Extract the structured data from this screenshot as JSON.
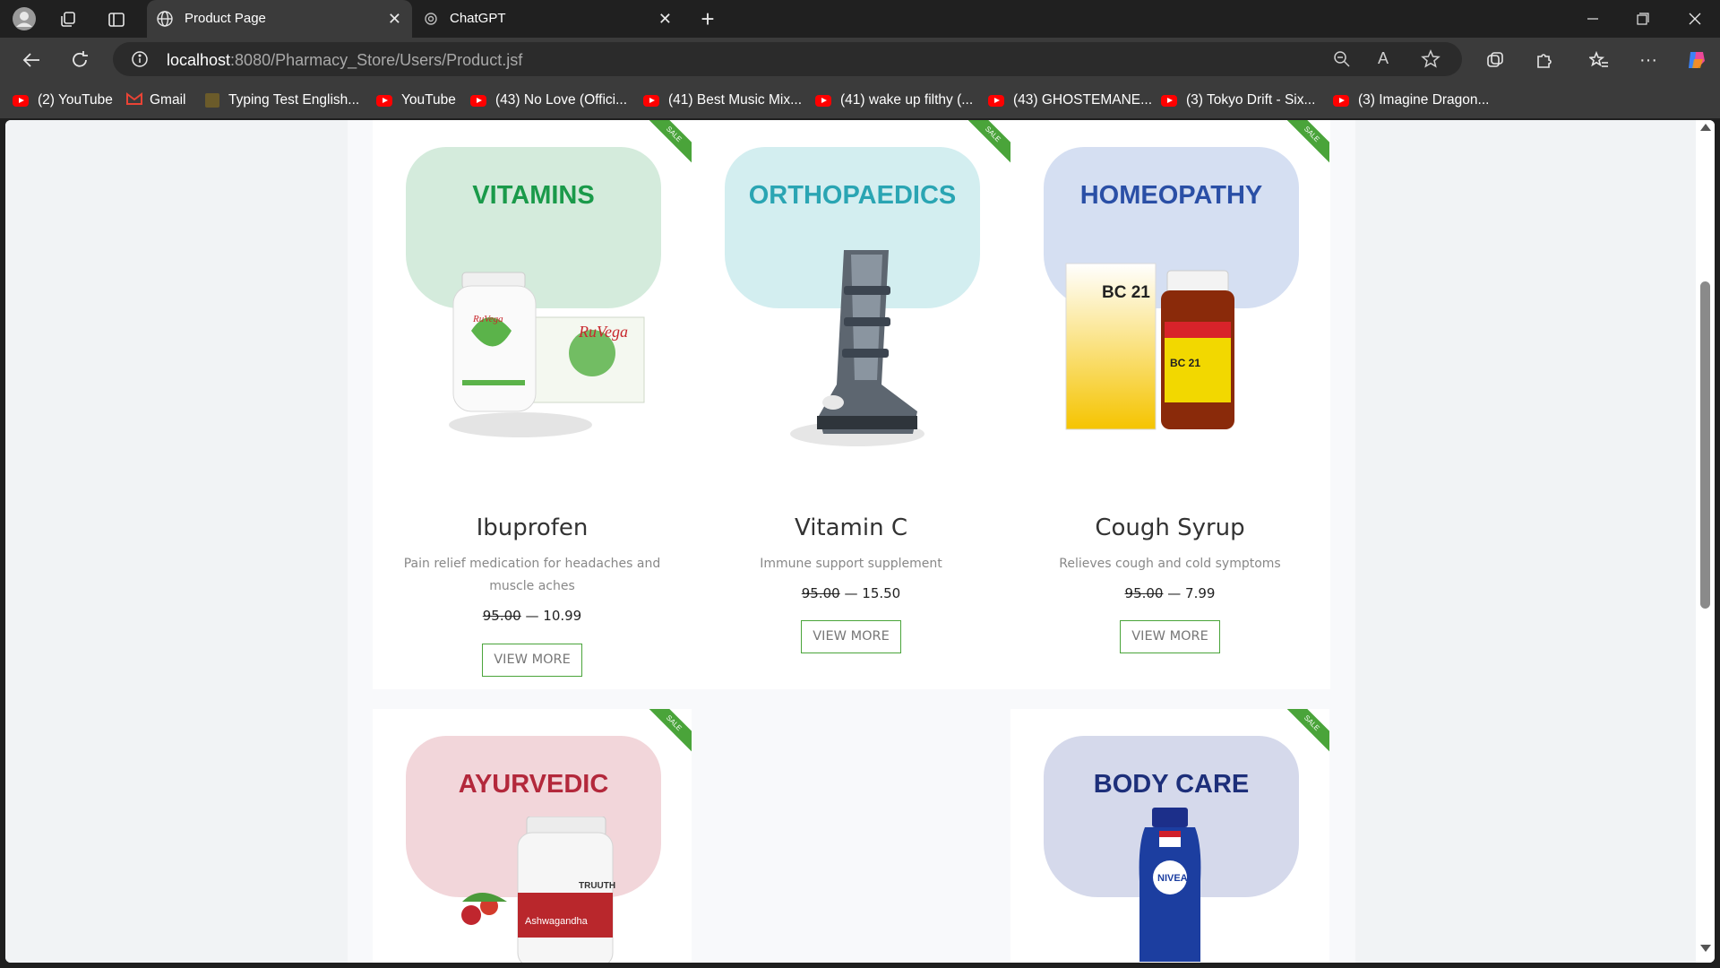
{
  "browser": {
    "tabs": [
      {
        "title": "Product Page",
        "active": true
      },
      {
        "title": "ChatGPT",
        "active": false
      }
    ],
    "url_host": "localhost",
    "url_path": ":8080/Pharmacy_Store/Users/Product.jsf",
    "bookmarks": [
      "(2) YouTube",
      "Gmail",
      "Typing Test English...",
      "YouTube",
      "(43) No Love (Offici...",
      "(41) Best Music Mix...",
      "(41) wake up filthy (...",
      "(43) GHOSTEMANE...",
      "(3) Tokyo Drift - Six...",
      "(3) Imagine Dragon..."
    ]
  },
  "sale_label": "SALE",
  "products": [
    {
      "category": "VITAMINS",
      "category_color": "#1a9a4a",
      "blob_color": "#d4ebdc",
      "name": "Ibuprofen",
      "description": "Pain relief medication for headaches and muscle aches",
      "old_price": "95.00",
      "separator": "—",
      "price": "10.99",
      "button": "VIEW MORE"
    },
    {
      "category": "ORTHOPAEDICS",
      "category_color": "#2aa5b3",
      "blob_color": "#d3eef0",
      "name": "Vitamin C",
      "description": "Immune support supplement",
      "old_price": "95.00",
      "separator": "—",
      "price": "15.50",
      "button": "VIEW MORE"
    },
    {
      "category": "HOMEOPATHY",
      "category_color": "#2a4fa6",
      "blob_color": "#d5dff2",
      "name": "Cough Syrup",
      "description": "Relieves cough and cold symptoms",
      "old_price": "95.00",
      "separator": "—",
      "price": "7.99",
      "button": "VIEW MORE"
    },
    {
      "category": "AYURVEDIC",
      "category_color": "#b3283b",
      "blob_color": "#f2d6da",
      "name": "",
      "description": "",
      "old_price": "",
      "separator": "",
      "price": "",
      "button": ""
    },
    {
      "category": "BODY CARE",
      "category_color": "#1d2f7a",
      "blob_color": "#d5d9eb",
      "name": "",
      "description": "",
      "old_price": "",
      "separator": "",
      "price": "",
      "button": ""
    }
  ],
  "product_image_text": {
    "bc21": "BC 21",
    "ruvega": "RuVega",
    "nivea": "NIVEA",
    "truth": "TRUUTH",
    "ashwagandha": "Ashwagandha"
  }
}
